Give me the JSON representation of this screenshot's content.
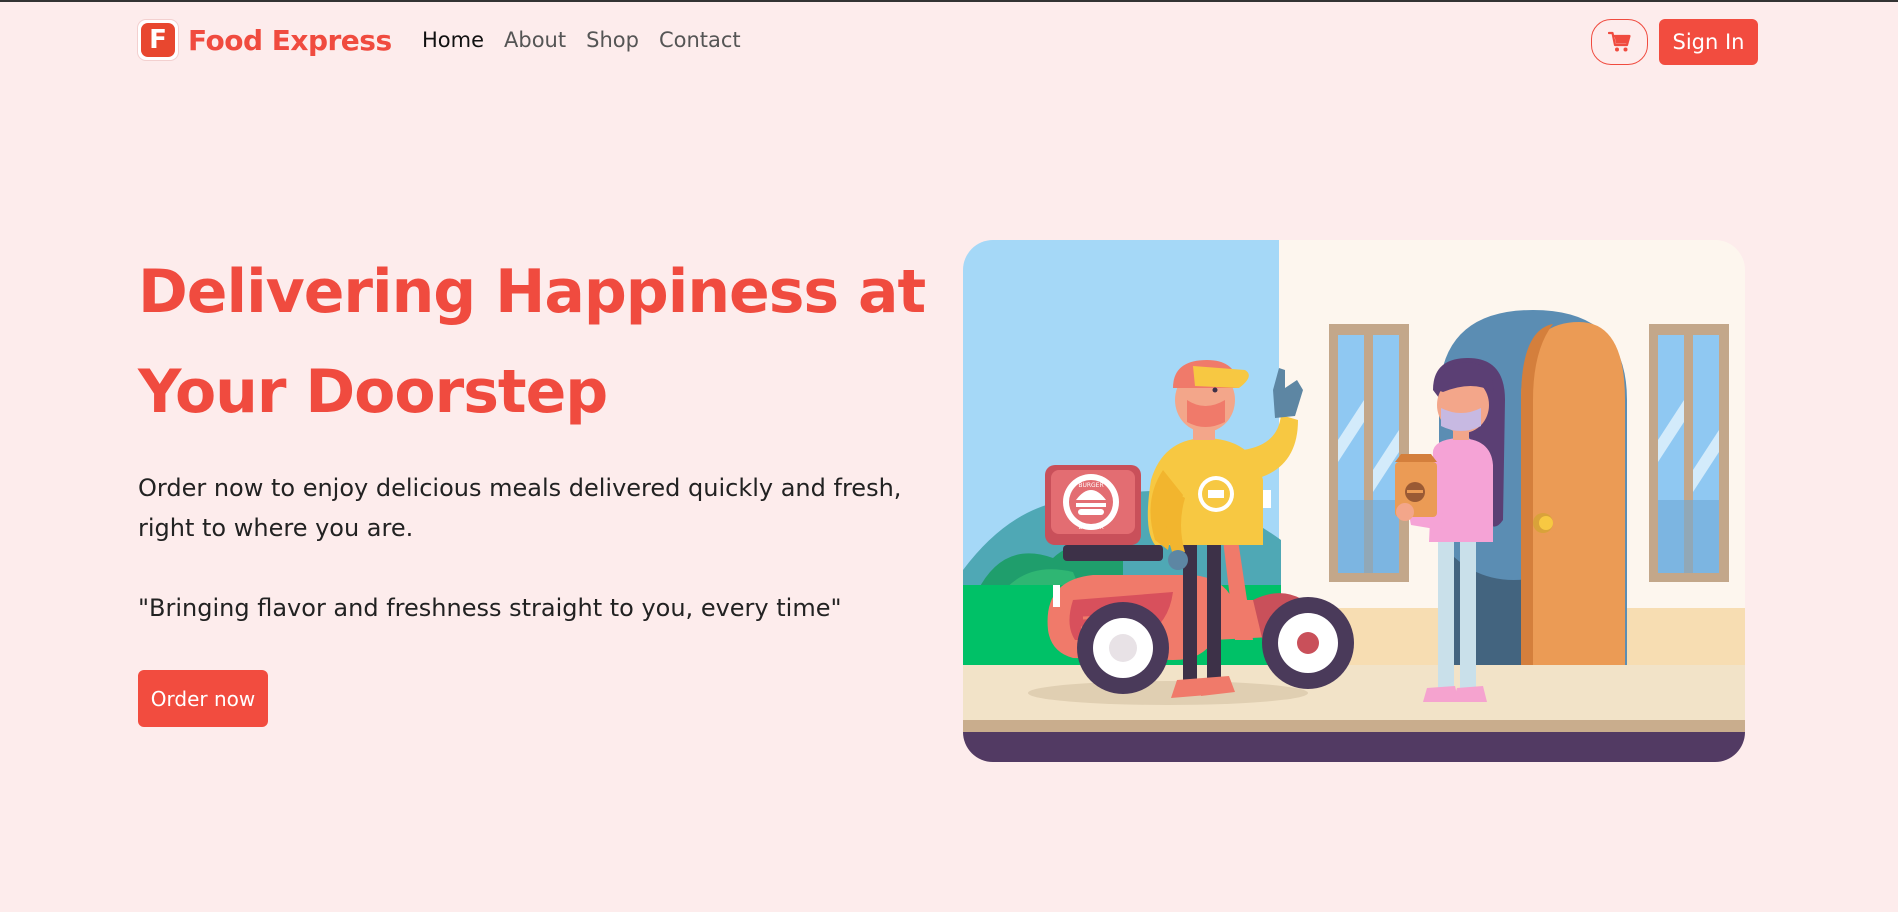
{
  "brand": {
    "logo_letter": "F",
    "name": "Food Express"
  },
  "nav": {
    "links": [
      {
        "label": "Home",
        "active": true
      },
      {
        "label": "About",
        "active": false
      },
      {
        "label": "Shop",
        "active": false
      },
      {
        "label": "Contact",
        "active": false
      }
    ],
    "cart_icon": "shopping-cart-icon",
    "signin_label": "Sign In"
  },
  "hero": {
    "title_line1": "Delivering Happiness at",
    "title_line2": "Your Doorstep",
    "subtitle": "Order now to enjoy delicious meals delivered quickly and fresh, right to where you are.",
    "quote": "\"Bringing flavor and freshness straight to you, every time\"",
    "cta_label": "Order now",
    "illustration": "delivery-scooter-illustration",
    "illustration_texts": {
      "box_top": "BURGER",
      "box_bottom": "BURGER"
    }
  },
  "colors": {
    "background": "#fdecec",
    "accent": "#f24c3f",
    "brand_red": "#e8472f"
  }
}
